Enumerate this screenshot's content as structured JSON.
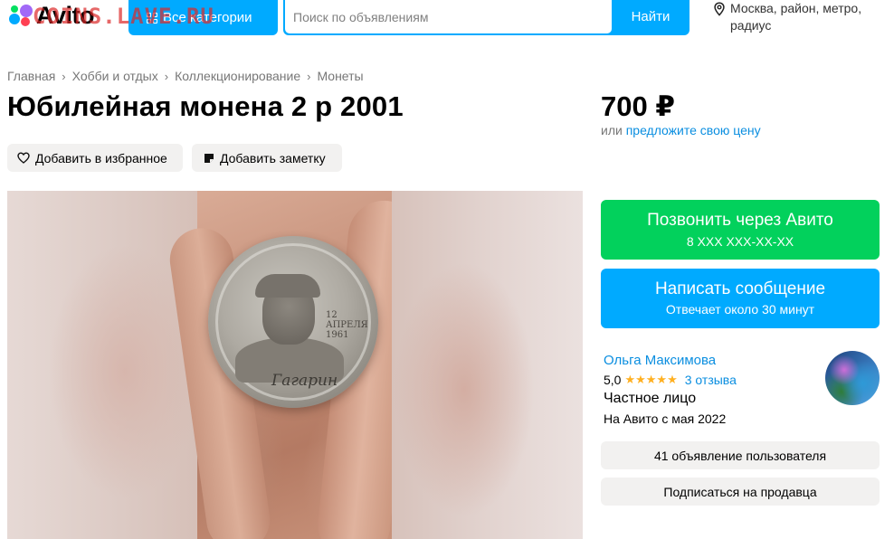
{
  "header": {
    "logo_text": "Avito",
    "watermark": "COINS.LAVE.RU",
    "categories_label": "Все категории",
    "search_placeholder": "Поиск по объявлениям",
    "search_button": "Найти",
    "location_line1": "Москва, район, метро,",
    "location_line2": "радиус"
  },
  "breadcrumbs": [
    "Главная",
    "Хобби и отдых",
    "Коллекционирование",
    "Монеты"
  ],
  "listing": {
    "title": "Юбилейная монена 2 р 2001",
    "price": "700 ₽",
    "price_or": "или",
    "price_offer_link": "предложите свою цену",
    "favorite_label": "Добавить в избранное",
    "note_label": "Добавить заметку"
  },
  "photo": {
    "coin_date": "12 АПРЕЛЯ 1961",
    "coin_signature": "Гагарин"
  },
  "contact": {
    "call_label": "Позвонить через Авито",
    "call_phone": "8 XXX XXX-XX-XX",
    "message_label": "Написать сообщение",
    "message_sub": "Отвечает около 30 минут"
  },
  "seller": {
    "name": "Ольга Максимова",
    "rating": "5,0",
    "stars": "★★★★★",
    "reviews": "3 отзыва",
    "type": "Частное лицо",
    "since": "На Авито с мая 2022",
    "ads_label": "41 объявление пользователя",
    "subscribe_label": "Подписаться на продавца"
  },
  "colors": {
    "accent_blue": "#00aaff",
    "call_green": "#02d15c",
    "link_blue": "#0a8ee0",
    "pill_bg": "#f2f1f0"
  }
}
